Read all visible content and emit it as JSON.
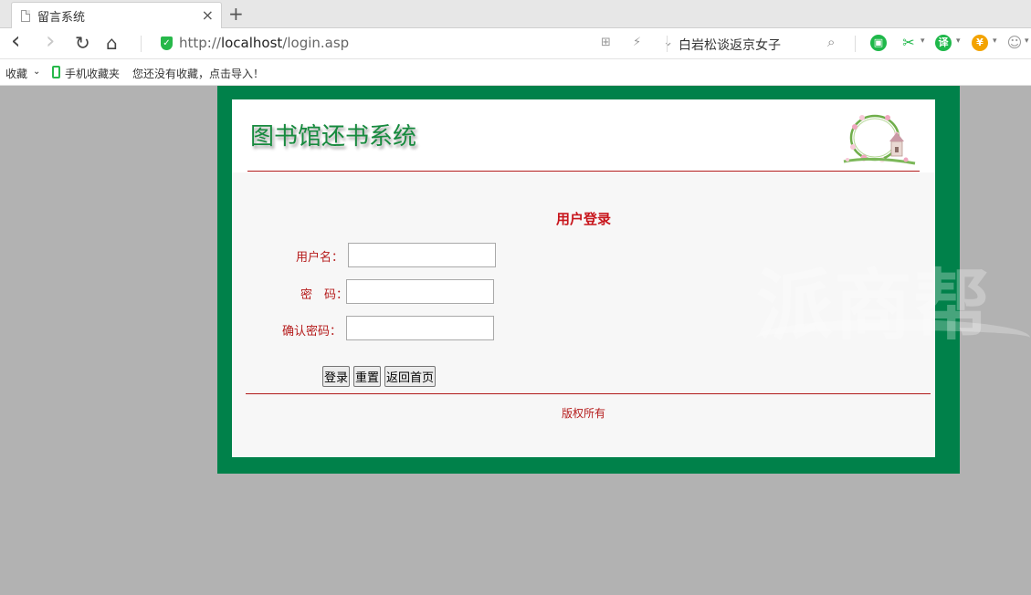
{
  "browser": {
    "tab_title": "留言系统",
    "tab_close": "×",
    "new_tab": "+",
    "url_prefix": "http://",
    "url_host": "localhost",
    "url_path": "/login.asp",
    "addr_icons": "⊞ ⚡ ⌄",
    "search_text": "白岩松谈返京女子",
    "nav": {
      "back": "‹",
      "forward": "›",
      "reload": "↻",
      "home": "⌂"
    }
  },
  "bookmarks": {
    "favorites": "收藏",
    "favorites_caret": "⌄",
    "mobile_favorites": "手机收藏夹",
    "import_hint": "您还没有收藏，点击导入！"
  },
  "extensions": [
    {
      "name": "wechat-icon",
      "glyph": "▣",
      "color": "#1fb84a"
    },
    {
      "name": "scissors-icon",
      "glyph": "✂",
      "color": "#1fb84a"
    },
    {
      "name": "translate-icon",
      "glyph": "译",
      "color": "#1fb84a"
    },
    {
      "name": "coupon-icon",
      "glyph": "¥",
      "color": "#f3a300"
    },
    {
      "name": "game-icon",
      "glyph": "☺",
      "color": "#999999"
    }
  ],
  "page": {
    "site_title": "图书馆还书系统",
    "login_title": "用户登录",
    "labels": {
      "username": "用户名：",
      "password": "密　码：",
      "confirm_password": "确认密码："
    },
    "inputs": {
      "username": "",
      "password": "",
      "confirm_password": ""
    },
    "buttons": {
      "login": "登录",
      "reset": "重置",
      "back_home": "返回首页"
    },
    "copyright": "版权所有"
  },
  "watermark": "派商帮",
  "colors": {
    "frame_green": "#00814a",
    "title_green": "#178a3e",
    "accent_red": "#c8161d"
  }
}
